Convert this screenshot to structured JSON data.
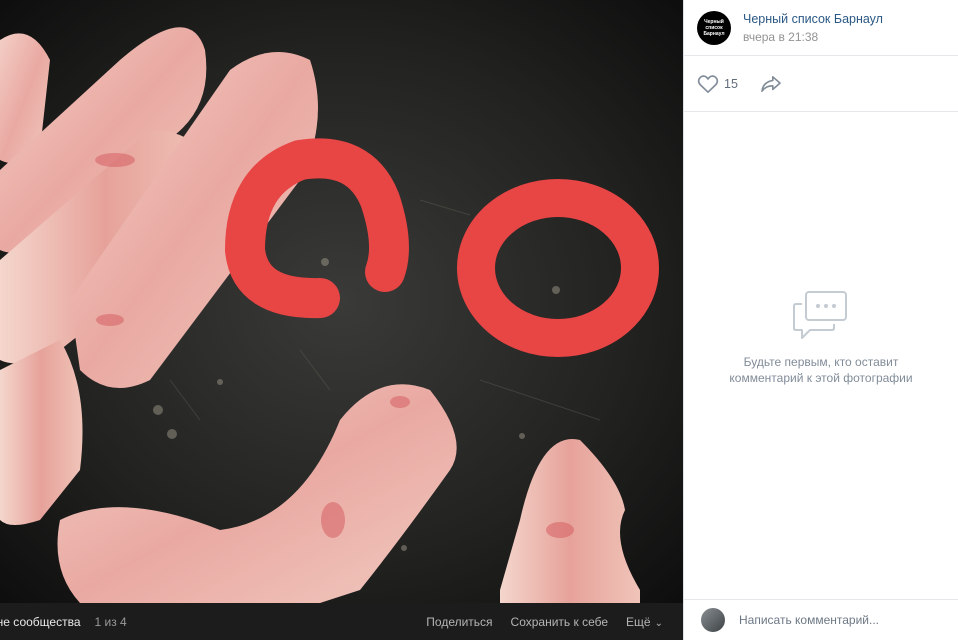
{
  "photo": {
    "album_name": "ене сообщества",
    "counter": "1 из 4",
    "actions": {
      "share": "Поделиться",
      "save": "Сохранить к себе",
      "more": "Ещё"
    }
  },
  "author": {
    "avatar_text": [
      "Черный",
      "список",
      "Барнаул"
    ],
    "name": "Черный список Барнаул",
    "time": "вчера в 21:38"
  },
  "reactions": {
    "likes": "15"
  },
  "comments": {
    "empty_text": "Будьте первым, кто оставит комментарий к этой фотографии",
    "input_placeholder": "Написать комментарий..."
  },
  "icons": {
    "like": "heart-icon",
    "share": "share-arrow-icon",
    "empty": "comments-bubble-icon",
    "more": "chevron-down-icon"
  },
  "colors": {
    "link": "#2a5885",
    "muted": "#939393",
    "annotation_red": "#e84545",
    "photo_bar": "#1c1c1c"
  }
}
